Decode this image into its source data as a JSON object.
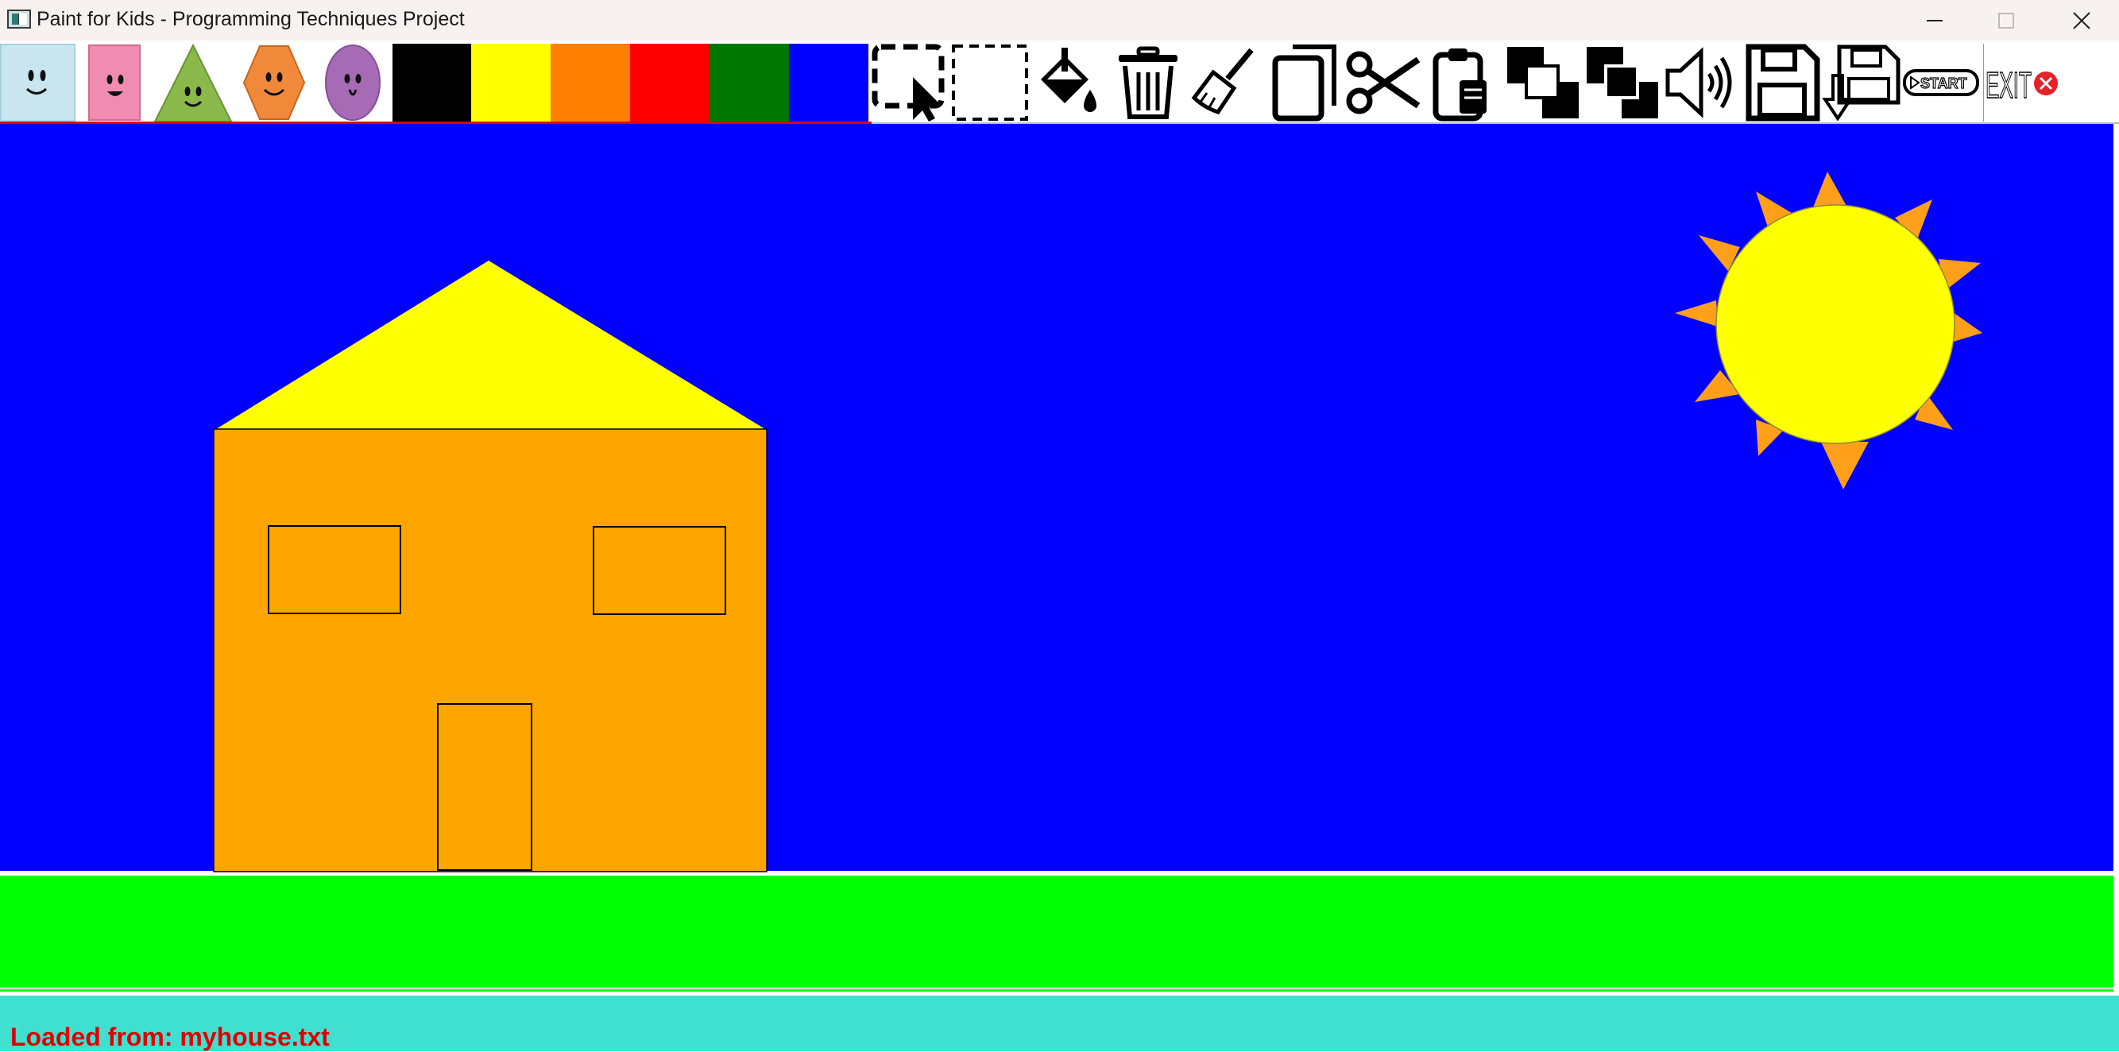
{
  "window": {
    "title": "Paint for Kids - Programming Techniques Project"
  },
  "toolbar": {
    "shape_tools": [
      {
        "name": "square-face-shape-icon",
        "color": "#c9e6f0"
      },
      {
        "name": "rectangle-face-shape-icon",
        "color": "#f08cb0"
      },
      {
        "name": "triangle-face-shape-icon",
        "color": "#8bb84a"
      },
      {
        "name": "hexagon-face-shape-icon",
        "color": "#f08a3a"
      },
      {
        "name": "circle-face-shape-icon",
        "color": "#a66bb4"
      }
    ],
    "palette": [
      "#000000",
      "#ffff00",
      "#ff7f00",
      "#ff0000",
      "#007700",
      "#0000ff"
    ],
    "action_tools": [
      "select-icon",
      "multi-select-icon",
      "fill-bucket-icon",
      "delete-icon",
      "clear-broom-icon",
      "copy-icon",
      "cut-scissors-icon",
      "paste-clipboard-icon",
      "send-to-back-icon",
      "bring-to-front-icon",
      "sound-icon",
      "save-icon",
      "load-icon",
      "start-play-icon",
      "exit-icon"
    ],
    "start_label": "START",
    "exit_label": "EXIT"
  },
  "canvas": {
    "sky_color": "#0000ff",
    "ground_color": "#00ff00",
    "house": {
      "roof_color": "#ffff00",
      "wall_color": "#ffa500",
      "outline_color": "#000000"
    },
    "sun": {
      "body_color": "#ffff00",
      "ray_color": "#ff9f1a"
    }
  },
  "status": {
    "message": "Loaded from: myhouse.txt",
    "bar_color": "#40e0d0",
    "text_color": "#e00000"
  }
}
